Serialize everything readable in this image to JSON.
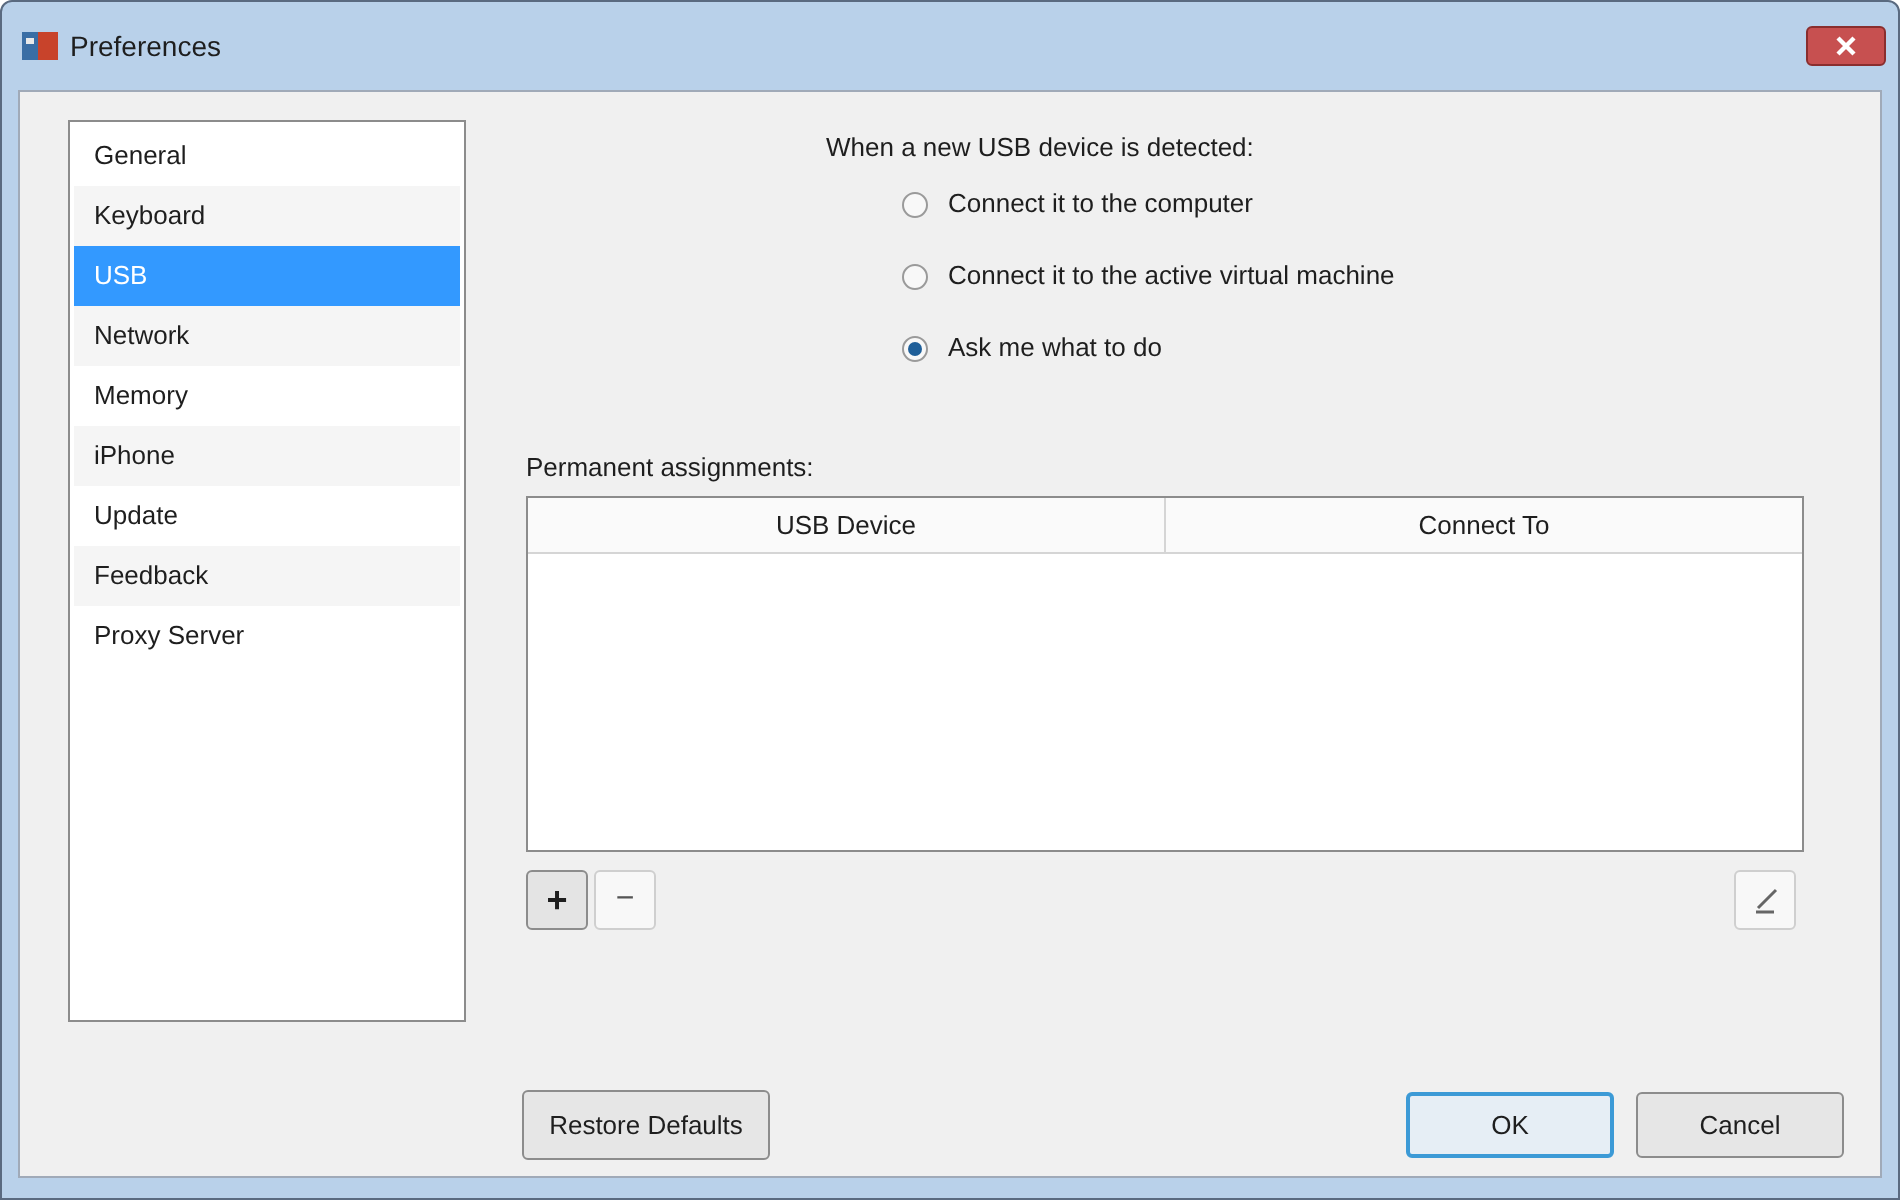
{
  "window": {
    "title": "Preferences"
  },
  "sidebar": {
    "items": [
      {
        "label": "General",
        "selected": false
      },
      {
        "label": "Keyboard",
        "selected": false
      },
      {
        "label": "USB",
        "selected": true
      },
      {
        "label": "Network",
        "selected": false
      },
      {
        "label": "Memory",
        "selected": false
      },
      {
        "label": "iPhone",
        "selected": false
      },
      {
        "label": "Update",
        "selected": false
      },
      {
        "label": "Feedback",
        "selected": false
      },
      {
        "label": "Proxy Server",
        "selected": false
      }
    ]
  },
  "usb": {
    "prompt": "When a new USB device is detected:",
    "options": [
      {
        "label": "Connect it to the computer",
        "selected": false
      },
      {
        "label": "Connect it to the active virtual machine",
        "selected": false
      },
      {
        "label": "Ask me what to do",
        "selected": true
      }
    ]
  },
  "assignments": {
    "label": "Permanent assignments:",
    "columns": [
      "USB Device",
      "Connect To"
    ],
    "add": "+",
    "remove": "−"
  },
  "buttons": {
    "restore": "Restore Defaults",
    "ok": "OK",
    "cancel": "Cancel"
  }
}
